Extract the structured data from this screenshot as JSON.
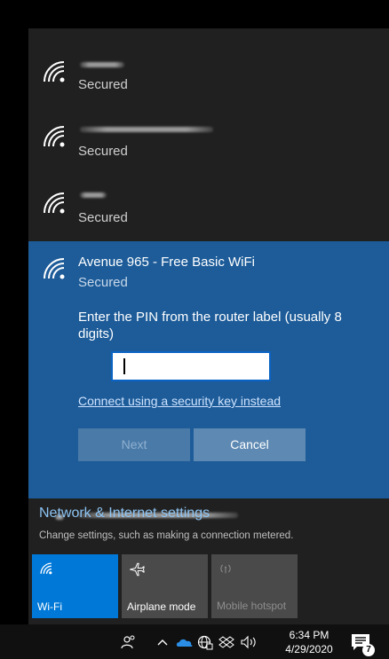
{
  "networks": [
    {
      "status": "Secured"
    },
    {
      "status": "Secured"
    },
    {
      "status": "Secured"
    }
  ],
  "selected_network": {
    "name": "Avenue 965 - Free Basic WiFi",
    "status": "Secured",
    "prompt": "Enter the PIN from the router label (usually 8 digits)",
    "pin_value": "",
    "alt_link": "Connect using a security key instead",
    "next_label": "Next",
    "cancel_label": "Cancel"
  },
  "settings": {
    "title": "Network & Internet settings",
    "subtitle": "Change settings, such as making a connection metered."
  },
  "quick_actions": [
    {
      "label": "Wi-Fi",
      "icon": "wifi-icon",
      "state": "on"
    },
    {
      "label": "Airplane mode",
      "icon": "airplane-icon",
      "state": "off"
    },
    {
      "label": "Mobile hotspot",
      "icon": "hotspot-icon",
      "state": "disabled"
    }
  ],
  "taskbar": {
    "time": "6:34 PM",
    "date": "4/29/2020",
    "notification_count": "7",
    "tray_icons": [
      "people-icon",
      "chevron-up-icon",
      "onedrive-icon",
      "network-globe-icon",
      "dropbox-icon",
      "volume-icon",
      "action-center-icon"
    ]
  },
  "colors": {
    "selected_bg": "#1d5c99",
    "panel_bg": "#202020",
    "wifi_tile": "#0078d7",
    "link": "#8cc3f2"
  }
}
